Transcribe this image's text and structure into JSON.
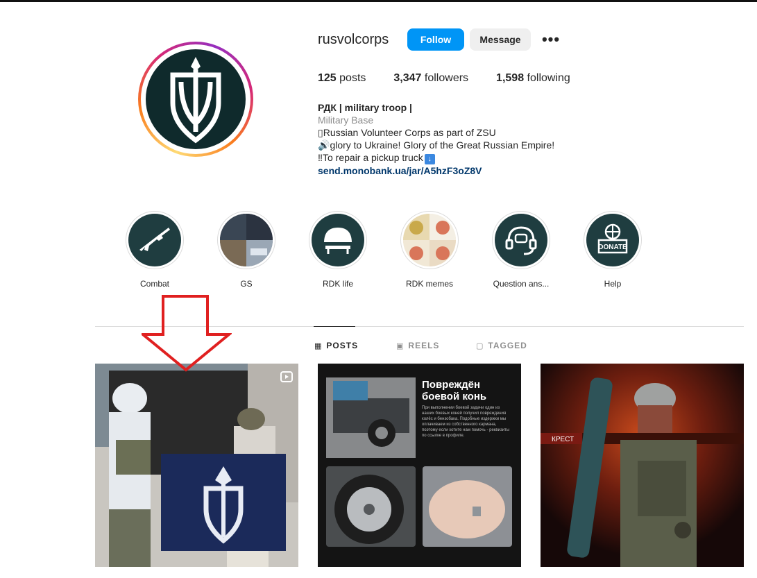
{
  "profile": {
    "username": "rusvolcorps",
    "follow_label": "Follow",
    "message_label": "Message",
    "more_label": "•••",
    "stats": {
      "posts_count": "125",
      "posts_label": "posts",
      "followers_count": "3,347",
      "followers_label": "followers",
      "following_count": "1,598",
      "following_label": "following"
    },
    "bio": {
      "name": "РДК | military troop |",
      "category": "Military Base",
      "line1": "Russian Volunteer Corps as part of ZSU",
      "line2": "glory to Ukraine! Glory of the Great Russian Empire!",
      "line3": "To repair a pickup truck",
      "link": "send.monobank.ua/jar/A5hzF3oZ8V"
    }
  },
  "highlights": [
    {
      "label": "Combat",
      "icon": "rifle-icon"
    },
    {
      "label": "GS",
      "icon": "photo-collage"
    },
    {
      "label": "RDK life",
      "icon": "helmet-icon"
    },
    {
      "label": "RDK memes",
      "icon": "meme-collage"
    },
    {
      "label": "Question ans...",
      "icon": "headset-icon"
    },
    {
      "label": "Help",
      "icon": "donate-icon"
    }
  ],
  "tabs": {
    "posts": "POSTS",
    "reels": "REELS",
    "tagged": "TAGGED"
  },
  "posts": {
    "post2_title": "Повреждён боевой конь",
    "post2_body": "При выполнении боевой задачи один из наших боевых коней получил повреждения колёс и бензобака. Подобные издержки мы оплачиваем из собственного кармана, поэтому если хотите нам помочь - реквизиты по ссылке в профиле.",
    "post3_caption": "КРЕСТ"
  },
  "colors": {
    "accent": "#0095f6",
    "link": "#00376b",
    "annotation_arrow": "#e02020"
  }
}
